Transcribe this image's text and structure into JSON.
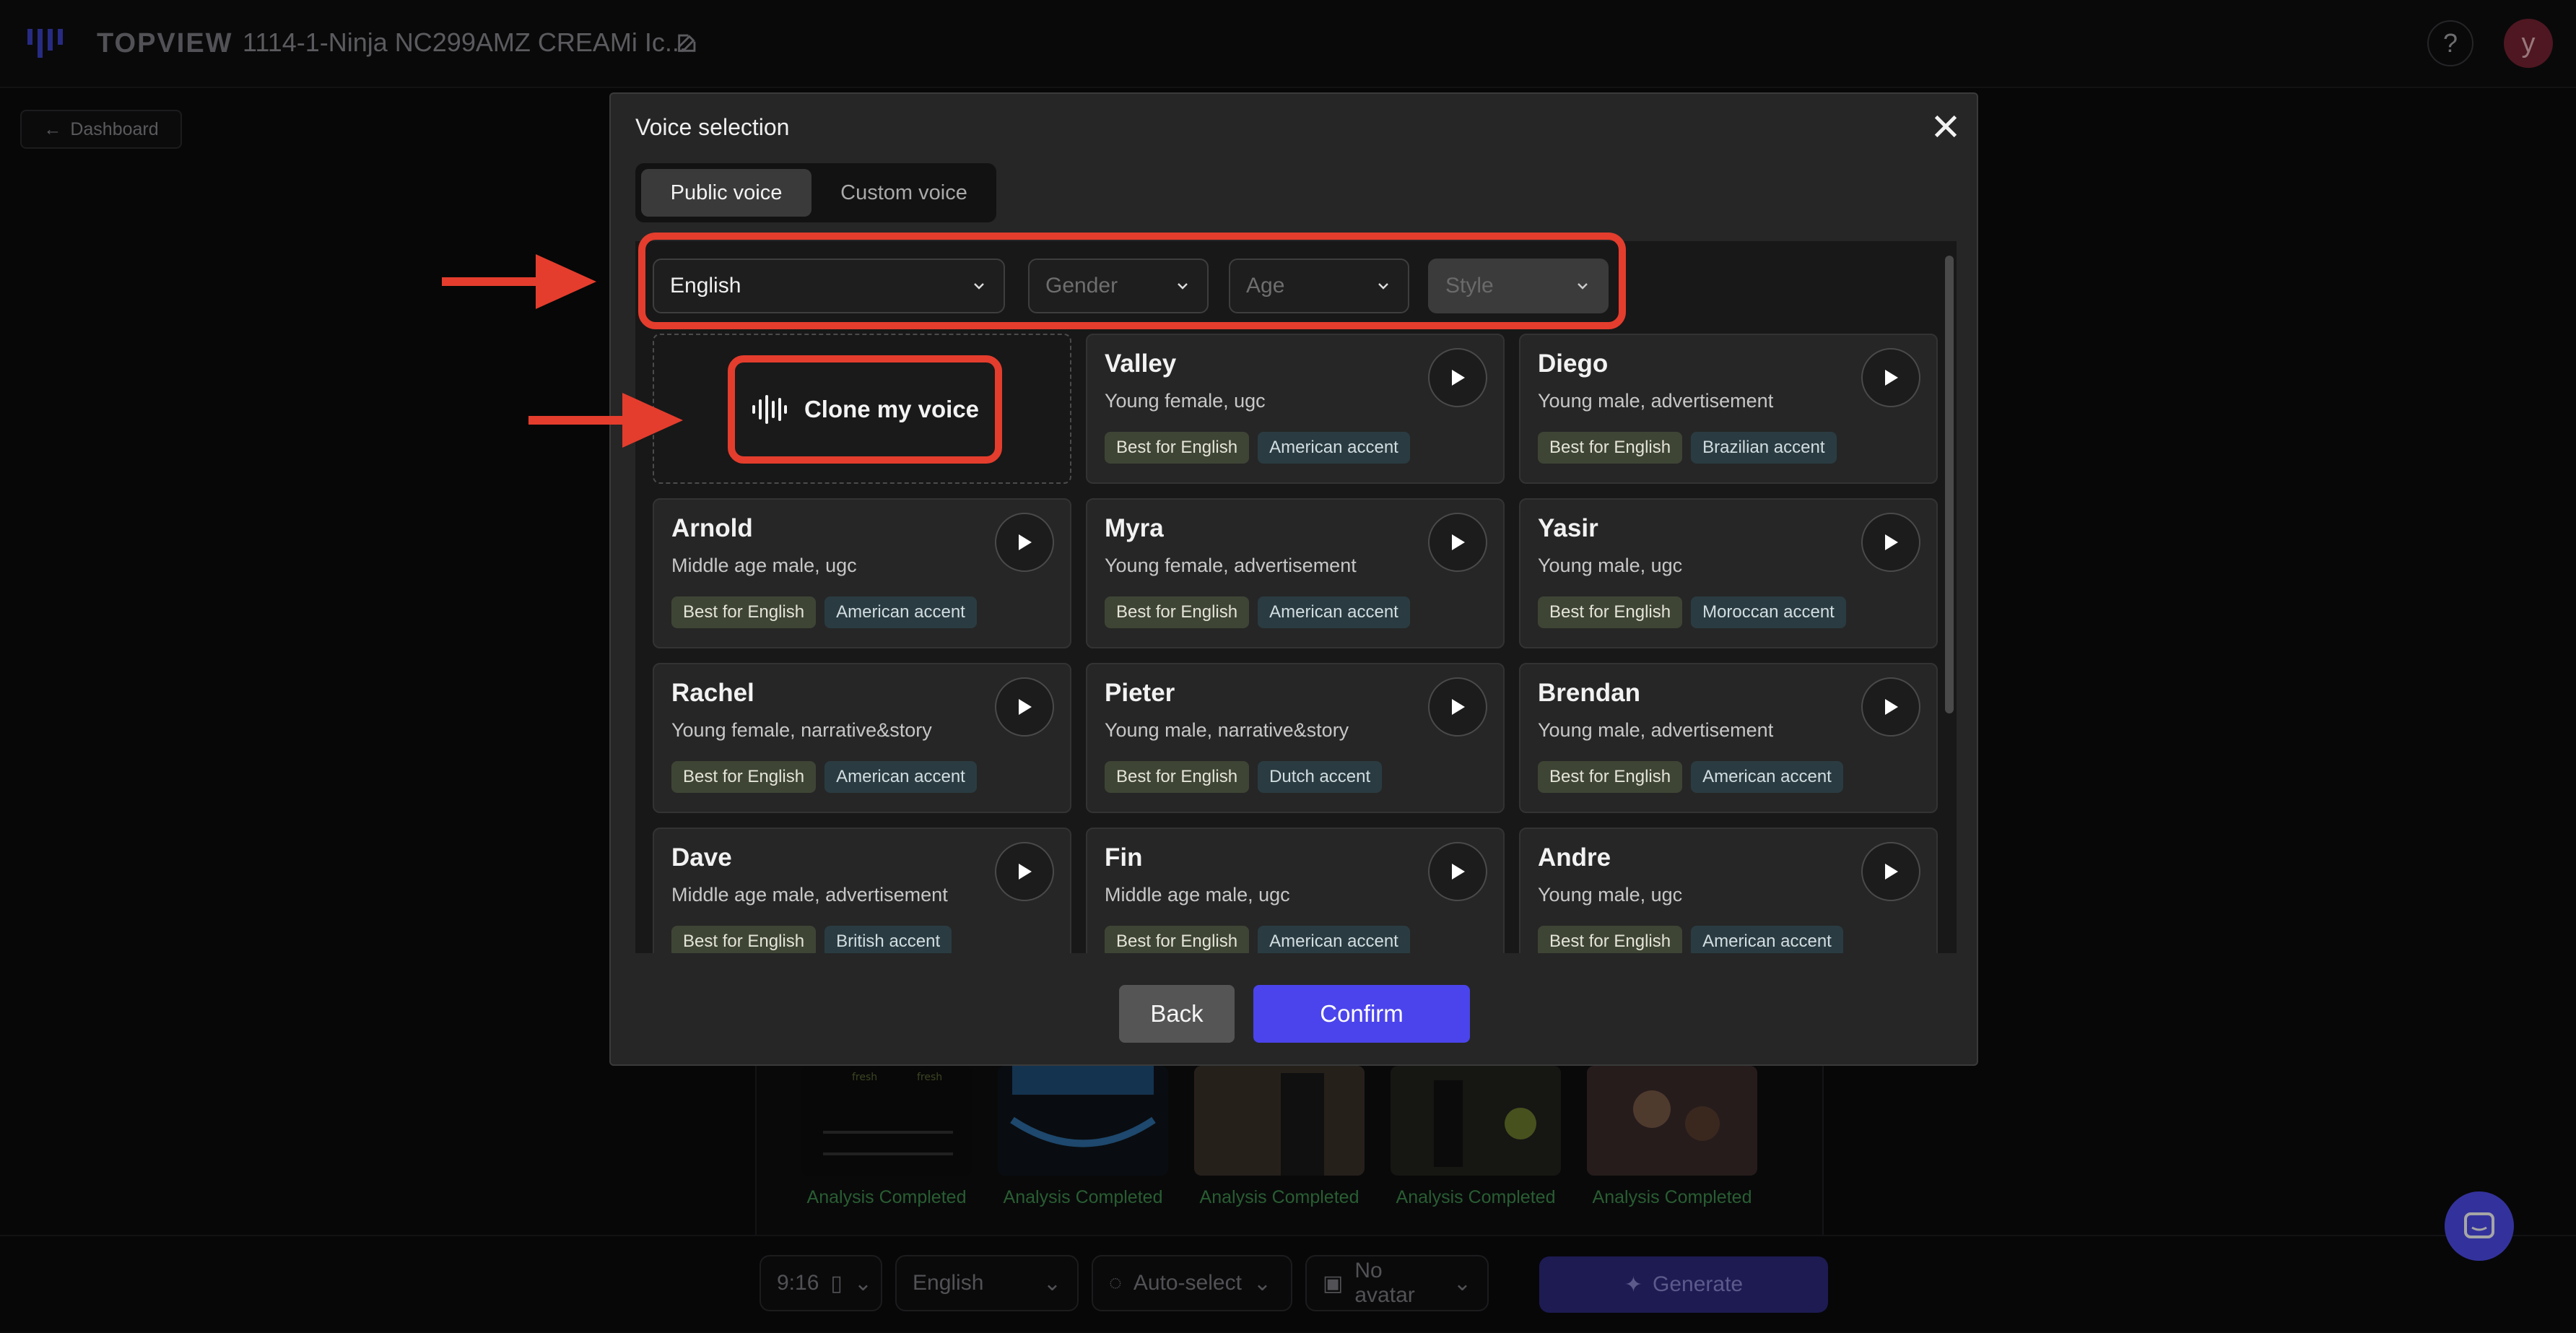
{
  "header": {
    "logo_text": "TOPVIEW",
    "project_title": "1114-1-Ninja NC299AMZ CREAMi Ic...",
    "help_label": "?",
    "avatar_letter": "y"
  },
  "nav": {
    "dashboard_label": "Dashboard"
  },
  "background": {
    "thumbnails": [
      {
        "label": "Analysis Completed"
      },
      {
        "label": "Analysis Completed"
      },
      {
        "label": "Analysis Completed"
      },
      {
        "label": "Analysis Completed"
      },
      {
        "label": "Analysis Completed"
      }
    ],
    "bottom_bar": {
      "ratio": "9:16",
      "language": "English",
      "voice": "Auto-select",
      "avatar": "No avatar",
      "generate": "Generate"
    }
  },
  "modal": {
    "title": "Voice selection",
    "tabs": {
      "public": "Public voice",
      "custom": "Custom voice"
    },
    "filters": {
      "language": "English",
      "gender_placeholder": "Gender",
      "age_placeholder": "Age",
      "style_placeholder": "Style"
    },
    "clone_label": "Clone my voice",
    "voices": [
      {
        "name": "Valley",
        "desc": "Young female, ugc",
        "tags": [
          "Best for English",
          "American accent"
        ]
      },
      {
        "name": "Diego",
        "desc": "Young male, advertisement",
        "tags": [
          "Best for English",
          "Brazilian accent"
        ]
      },
      {
        "name": "Arnold",
        "desc": "Middle age male, ugc",
        "tags": [
          "Best for English",
          "American accent"
        ]
      },
      {
        "name": "Myra",
        "desc": "Young female, advertisement",
        "tags": [
          "Best for English",
          "American accent"
        ]
      },
      {
        "name": "Yasir",
        "desc": "Young male, ugc",
        "tags": [
          "Best for English",
          "Moroccan accent"
        ]
      },
      {
        "name": "Rachel",
        "desc": "Young female, narrative&story",
        "tags": [
          "Best for English",
          "American accent"
        ]
      },
      {
        "name": "Pieter",
        "desc": "Young male, narrative&story",
        "tags": [
          "Best for English",
          "Dutch accent"
        ]
      },
      {
        "name": "Brendan",
        "desc": "Young male, advertisement",
        "tags": [
          "Best for English",
          "American accent"
        ]
      },
      {
        "name": "Dave",
        "desc": "Middle age male, advertisement",
        "tags": [
          "Best for English",
          "British accent"
        ]
      },
      {
        "name": "Fin",
        "desc": "Middle age male, ugc",
        "tags": [
          "Best for English",
          "American accent"
        ]
      },
      {
        "name": "Andre",
        "desc": "Young male, ugc",
        "tags": [
          "Best for English",
          "American accent"
        ]
      }
    ],
    "back_label": "Back",
    "confirm_label": "Confirm"
  },
  "colors": {
    "accent": "#4b44ec",
    "annotation": "#e43d2d",
    "status_green": "#3f8f4d"
  }
}
